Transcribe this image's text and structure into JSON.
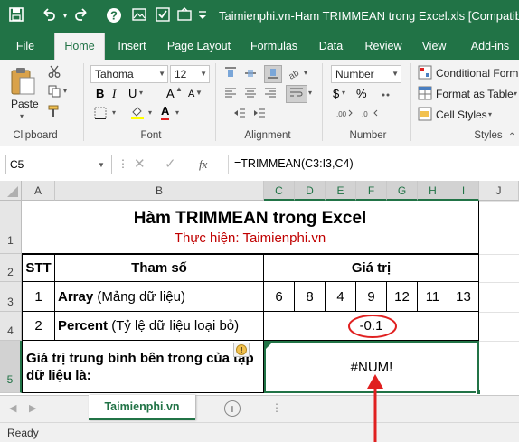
{
  "titlebar": {
    "title": "Taimienphi.vn-Ham TRIMMEAN trong Excel.xls  [Compatibility",
    "save_icon": "save-icon",
    "undo_icon": "undo-icon",
    "redo_icon": "redo-icon",
    "help_icon": "help-icon",
    "bg_color": "#217346"
  },
  "tabs": [
    "File",
    "Home",
    "Insert",
    "Page Layout",
    "Formulas",
    "Data",
    "Review",
    "View",
    "Add-ins"
  ],
  "ribbon": {
    "clipboard": {
      "paste_label": "Paste",
      "group_label": "Clipboard"
    },
    "font": {
      "font_name": "Tahoma",
      "font_size": "12",
      "bold": "B",
      "italic": "I",
      "underline": "U",
      "grow": "A",
      "shrink": "A",
      "font_color_letter": "A",
      "group_label": "Font"
    },
    "alignment": {
      "group_label": "Alignment"
    },
    "number": {
      "format": "Number",
      "currency": "$",
      "percent": "%",
      "group_label": "Number"
    },
    "styles": {
      "conditional": "Conditional Form",
      "format_table": "Format as Table",
      "cell_styles": "Cell Styles",
      "group_label": "Styles"
    }
  },
  "formula_bar": {
    "name_box": "C5",
    "fx": "fx",
    "formula": "=TRIMMEAN(C3:I3,C4)"
  },
  "columns": [
    "A",
    "B",
    "C",
    "D",
    "E",
    "F",
    "G",
    "H",
    "I",
    "J"
  ],
  "rows": [
    "1",
    "2",
    "3",
    "4",
    "5"
  ],
  "sheet": {
    "title": "Hàm TRIMMEAN trong Excel",
    "subtitle": "Thực hiện: Taimienphi.vn",
    "stt_header": "STT",
    "param_header": "Tham số",
    "value_header": "Giá trị",
    "row3_no": "1",
    "row3_bold": "Array",
    "row3_note": " (Mảng dữ liệu)",
    "row3_values": [
      "6",
      "8",
      "4",
      "9",
      "12",
      "11",
      "13"
    ],
    "row4_no": "2",
    "row4_bold": "Percent",
    "row4_note": " (Tỷ lệ dữ liệu loại bỏ)",
    "row4_value": "-0.1",
    "row5_label": "Giá trị trung bình bên trong của tập dữ liệu là:",
    "row5_value": "#NUM!",
    "title_color": "#000000",
    "subtitle_color": "#c00000",
    "annotation_color": "#e02020"
  },
  "sheet_tabs": {
    "active": "Taimienphi.vn",
    "add": "+"
  },
  "status": {
    "text": "Ready"
  }
}
